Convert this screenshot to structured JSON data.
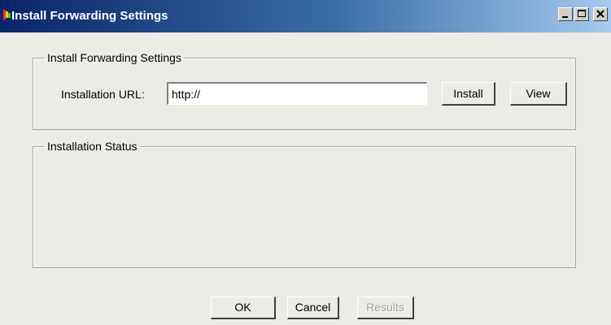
{
  "window": {
    "title": "Install Forwarding Settings",
    "controls": {
      "minimize": "minimize-icon",
      "maximize": "maximize-icon",
      "close": "close-icon"
    }
  },
  "settings_group": {
    "legend": "Install Forwarding Settings",
    "url_label": "Installation URL:",
    "url_value": "http://",
    "install_label": "Install",
    "view_label": "View"
  },
  "status_group": {
    "legend": "Installation Status"
  },
  "footer": {
    "ok_label": "OK",
    "cancel_label": "Cancel",
    "results_label": "Results"
  },
  "colors": {
    "titlebar_start": "#0a246a",
    "titlebar_end": "#a6caf0",
    "face": "#ecebe6"
  }
}
